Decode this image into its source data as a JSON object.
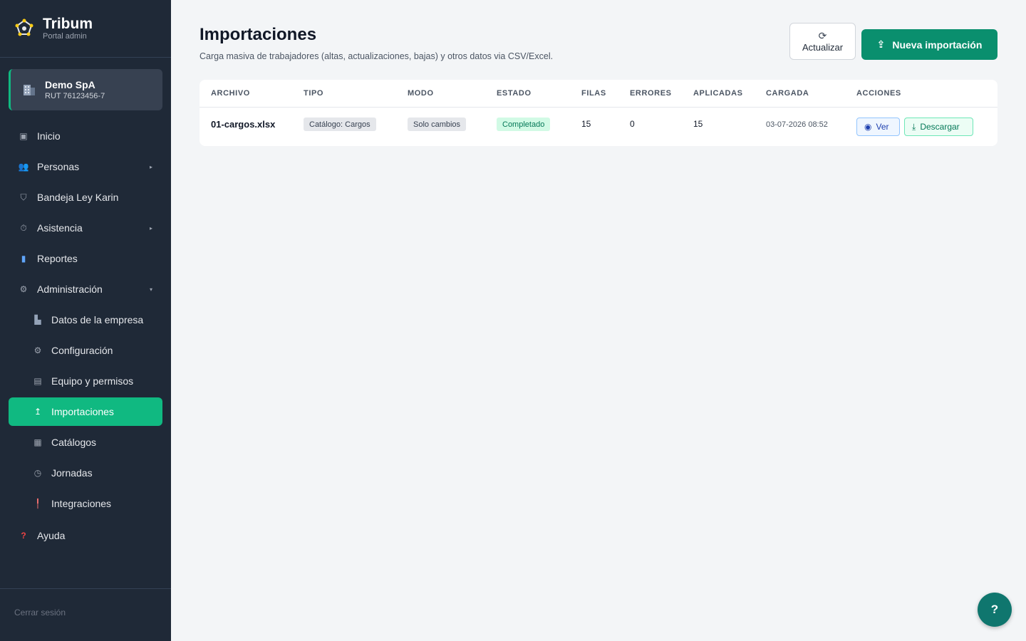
{
  "brand": {
    "name": "Tribum",
    "subtitle": "Portal admin"
  },
  "company": {
    "name": "Demo SpA",
    "rut": "RUT 76123456-7"
  },
  "nav": [
    {
      "label": "Inicio",
      "icon": "home-icon"
    },
    {
      "label": "Personas",
      "icon": "people-icon",
      "expandable": true
    },
    {
      "label": "Bandeja Ley Karin",
      "icon": "shield-icon"
    },
    {
      "label": "Asistencia",
      "icon": "clock-icon",
      "expandable": true
    },
    {
      "label": "Reportes",
      "icon": "chart-icon"
    },
    {
      "label": "Administración",
      "icon": "gear-icon",
      "expanded": true
    },
    {
      "label": "Datos de la empresa",
      "icon": "building-icon",
      "sub": true
    },
    {
      "label": "Configuración",
      "icon": "gear-icon",
      "sub": true
    },
    {
      "label": "Equipo y permisos",
      "icon": "list-icon",
      "sub": true
    },
    {
      "label": "Importaciones",
      "icon": "upload-icon",
      "sub": true,
      "active": true
    },
    {
      "label": "Catálogos",
      "icon": "grid-icon",
      "sub": true
    },
    {
      "label": "Jornadas",
      "icon": "clock-icon",
      "sub": true
    },
    {
      "label": "Integraciones",
      "icon": "plug-icon",
      "sub": true
    },
    {
      "label": "Ayuda",
      "icon": "question-icon"
    }
  ],
  "logout_label": "Cerrar sesión",
  "page": {
    "title": "Importaciones",
    "subtitle": "Carga masiva de trabajadores (altas, actualizaciones, bajas) y otros datos via CSV/Excel.",
    "refresh_label": "Actualizar",
    "new_label": "Nueva importación"
  },
  "table": {
    "headers": [
      "ARCHIVO",
      "TIPO",
      "MODO",
      "ESTADO",
      "FILAS",
      "ERRORES",
      "APLICADAS",
      "CARGADA",
      "ACCIONES"
    ],
    "rows": [
      {
        "archivo": "01-cargos.xlsx",
        "tipo": "Catálogo: Cargos",
        "modo": "Solo cambios",
        "estado": "Completado",
        "filas": "15",
        "errores": "0",
        "aplicadas": "15",
        "cargada": "03-07-2026 08:52",
        "ver_label": "Ver",
        "descargar_label": "Descargar"
      }
    ]
  },
  "help_fab_label": "?",
  "colors": {
    "sidebar_bg": "#1f2937",
    "accent": "#10b981",
    "primary_button": "#0a8f6e",
    "fab": "#0f766e"
  }
}
